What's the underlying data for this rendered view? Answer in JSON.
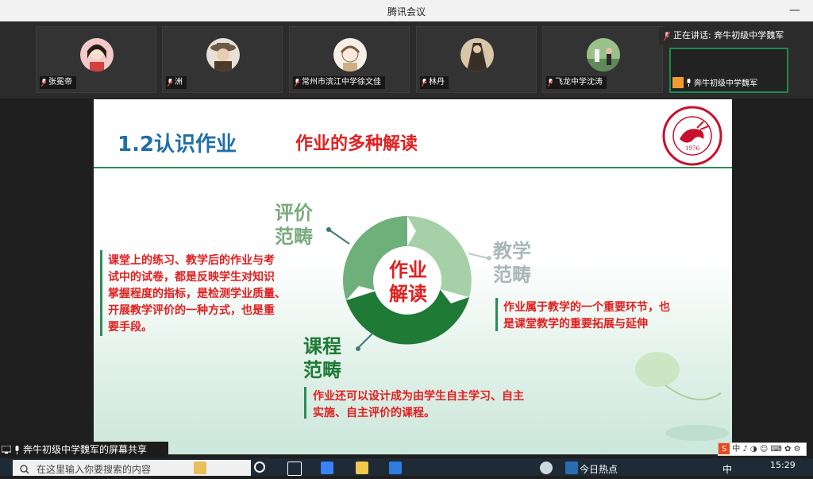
{
  "window": {
    "title": "腾讯会议",
    "minimize": "—"
  },
  "participants": [
    {
      "name": "张冕帝"
    },
    {
      "name": "洲"
    },
    {
      "name": "常州市滨江中学徐文佳"
    },
    {
      "name": "林丹"
    },
    {
      "name": "飞龙中学沈涛"
    }
  ],
  "speaking": {
    "text": "正在讲话: 奔牛初级中学魏军"
  },
  "self_tile": {
    "name": "奔牛初级中学魏军"
  },
  "slide": {
    "title": "1.2认识作业",
    "subtitle": "作业的多种解读",
    "center": [
      "作业",
      "解读"
    ],
    "eval_label": [
      "评价",
      "范畴"
    ],
    "eval_text": [
      "课堂上的练习、教学后的作业与考",
      "试中的试卷，都是反映学生对知识",
      "掌握程度的指标，是检测学业质量、",
      "开展教学评价的一种方式，也是重",
      "要手段。"
    ],
    "teach_label": [
      "教学",
      "范畴"
    ],
    "teach_text": [
      "作业属于教学的一个重要环节，也",
      "是课堂教学的重要拓展与延伸"
    ],
    "course_label": [
      "课程",
      "范畴"
    ],
    "course_text": [
      "作业还可以设计成为由学生自主学习、自主",
      "实施、自主评价的课程。"
    ],
    "logo_year": "1976",
    "logo_top": "奔牛初级中学",
    "logo_ring": "BENNIU JUNIOR HIGH SCHOOL"
  },
  "share_banner": {
    "text": "奔牛初级中学魏军的屏幕共享"
  },
  "ime_bar": {
    "text": "中 ♪ ◑ ☺ ⌨ ✿ ⚙"
  },
  "taskbar": {
    "search_placeholder": "在这里输入你要搜索的内容",
    "news": "今日热点",
    "ime": "中",
    "time": "15:29"
  },
  "colors": {
    "accent_green": "#2e8b57",
    "red": "#e02020",
    "blue": "#1f6fa8"
  }
}
